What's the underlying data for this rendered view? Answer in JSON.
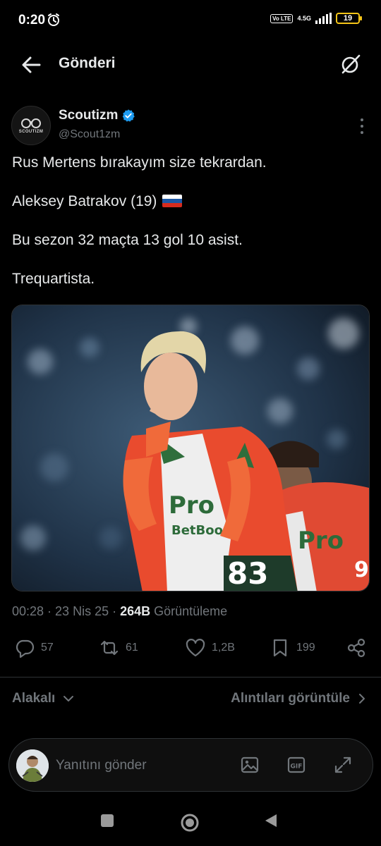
{
  "status_bar": {
    "time": "0:20",
    "volte": "Vo LTE",
    "network": "4.5G",
    "battery": "19"
  },
  "header": {
    "title": "Gönderi"
  },
  "author": {
    "name": "Scoutizm",
    "handle": "@Scout1zm",
    "avatar_text": "SCOUTIZM",
    "verified": true
  },
  "tweet": {
    "lines": [
      "Rus Mertens bırakayım size tekrardan.",
      "Aleksey Batrakov (19)",
      "Bu sezon 32 maçta 13 gol 10 asist.",
      "Trequartista."
    ],
    "flag": "russia-flag"
  },
  "media": {
    "sponsor": "BetBoom",
    "shirt_logo": "Pro",
    "shirt_number": "83",
    "second_shirt_number": "9"
  },
  "meta": {
    "time": "00:28",
    "separator1": " · ",
    "date": "23 Nis 25",
    "separator2": " · ",
    "views": "264B",
    "views_label": " Görüntüleme"
  },
  "actions": {
    "replies": "57",
    "reposts": "61",
    "likes": "1,2B",
    "bookmarks": "199"
  },
  "related": {
    "label": "Alakalı",
    "quotes_label": "Alıntıları görüntüle"
  },
  "reply_bar": {
    "placeholder": "Yanıtını gönder",
    "gif_label": "GIF"
  },
  "colors": {
    "background": "#000000",
    "text": "#e7e9ea",
    "muted": "#71767b",
    "verified": "#1d9bf0",
    "battery": "#f5c518",
    "divider": "#2f3336"
  }
}
